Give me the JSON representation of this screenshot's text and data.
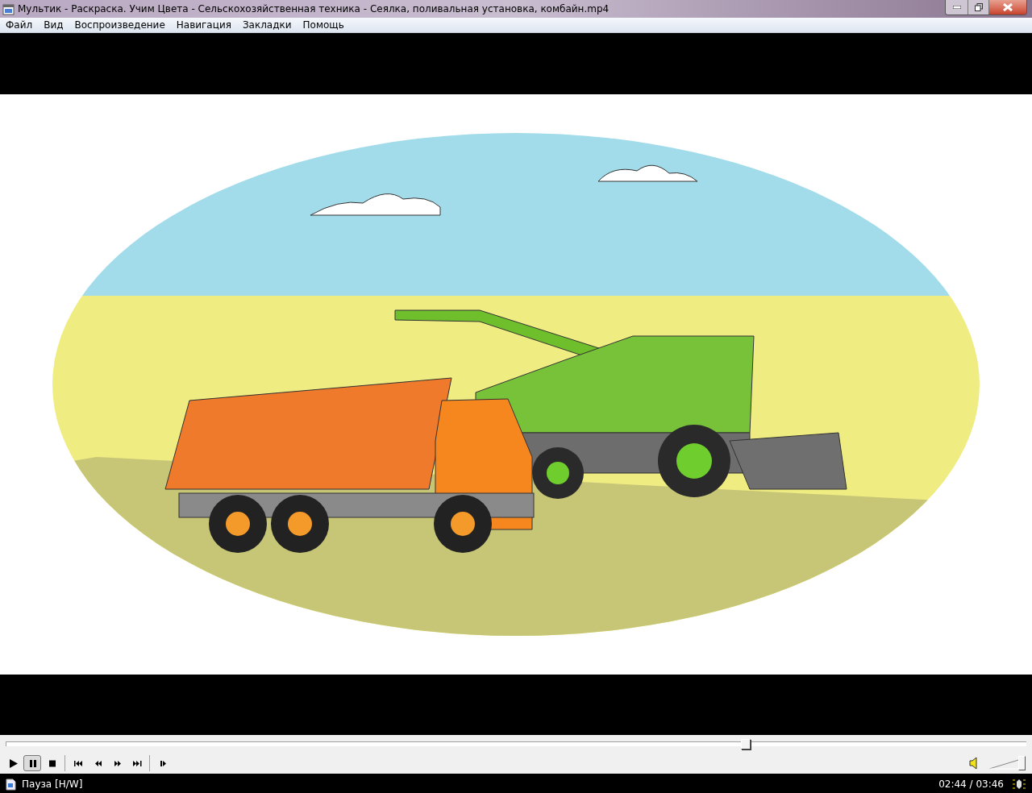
{
  "window": {
    "title": "Мультик - Раскраска. Учим Цвета - Сельскохозяйственная техника - Сеялка, поливальная установка, комбайн.mp4"
  },
  "menu": [
    "Файл",
    "Вид",
    "Воспроизведение",
    "Навигация",
    "Закладки",
    "Помощь"
  ],
  "seek": {
    "level": 0.725
  },
  "toolbar": {
    "groups": [
      [
        {
          "kind": "play",
          "selected": false
        },
        {
          "kind": "pause",
          "selected": true
        },
        {
          "kind": "stop",
          "selected": false
        }
      ],
      [
        {
          "kind": "prev",
          "selected": false
        },
        {
          "kind": "rewind",
          "selected": false
        },
        {
          "kind": "forward",
          "selected": false
        },
        {
          "kind": "next",
          "selected": false
        }
      ],
      [
        {
          "kind": "framestep",
          "selected": false
        }
      ]
    ]
  },
  "volume": {
    "level": 1
  },
  "status_bar": {
    "state": "Пауза [H/W]",
    "time": "02:44 / 03:46"
  }
}
